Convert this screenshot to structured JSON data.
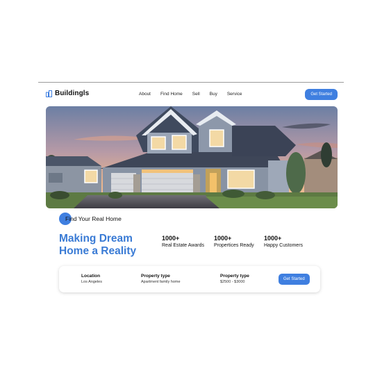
{
  "header": {
    "logo_text": "Buildingls",
    "nav": [
      "About",
      "Find Home",
      "Sell",
      "Buy",
      "Service"
    ],
    "cta_label": "Get Started"
  },
  "hero": {
    "image": "suburban-house-at-dusk"
  },
  "badge_text": "Find Your Real Home",
  "headline": "Making Dream Home a Reality",
  "stats": [
    {
      "value": "1000+",
      "label": "Real Estate Awards"
    },
    {
      "value": "1000+",
      "label": "Propertices Ready"
    },
    {
      "value": "1000+",
      "label": "Happy Customers"
    }
  ],
  "search": {
    "fields": [
      {
        "label": "Location",
        "value": "Los Angeles"
      },
      {
        "label": "Property type",
        "value": "Apartment family home"
      },
      {
        "label": "Property type",
        "value": "$2500 - $3000"
      }
    ],
    "button_label": "Get Started"
  },
  "colors": {
    "accent": "#3f7fe0",
    "headline": "#3a7bd5"
  }
}
